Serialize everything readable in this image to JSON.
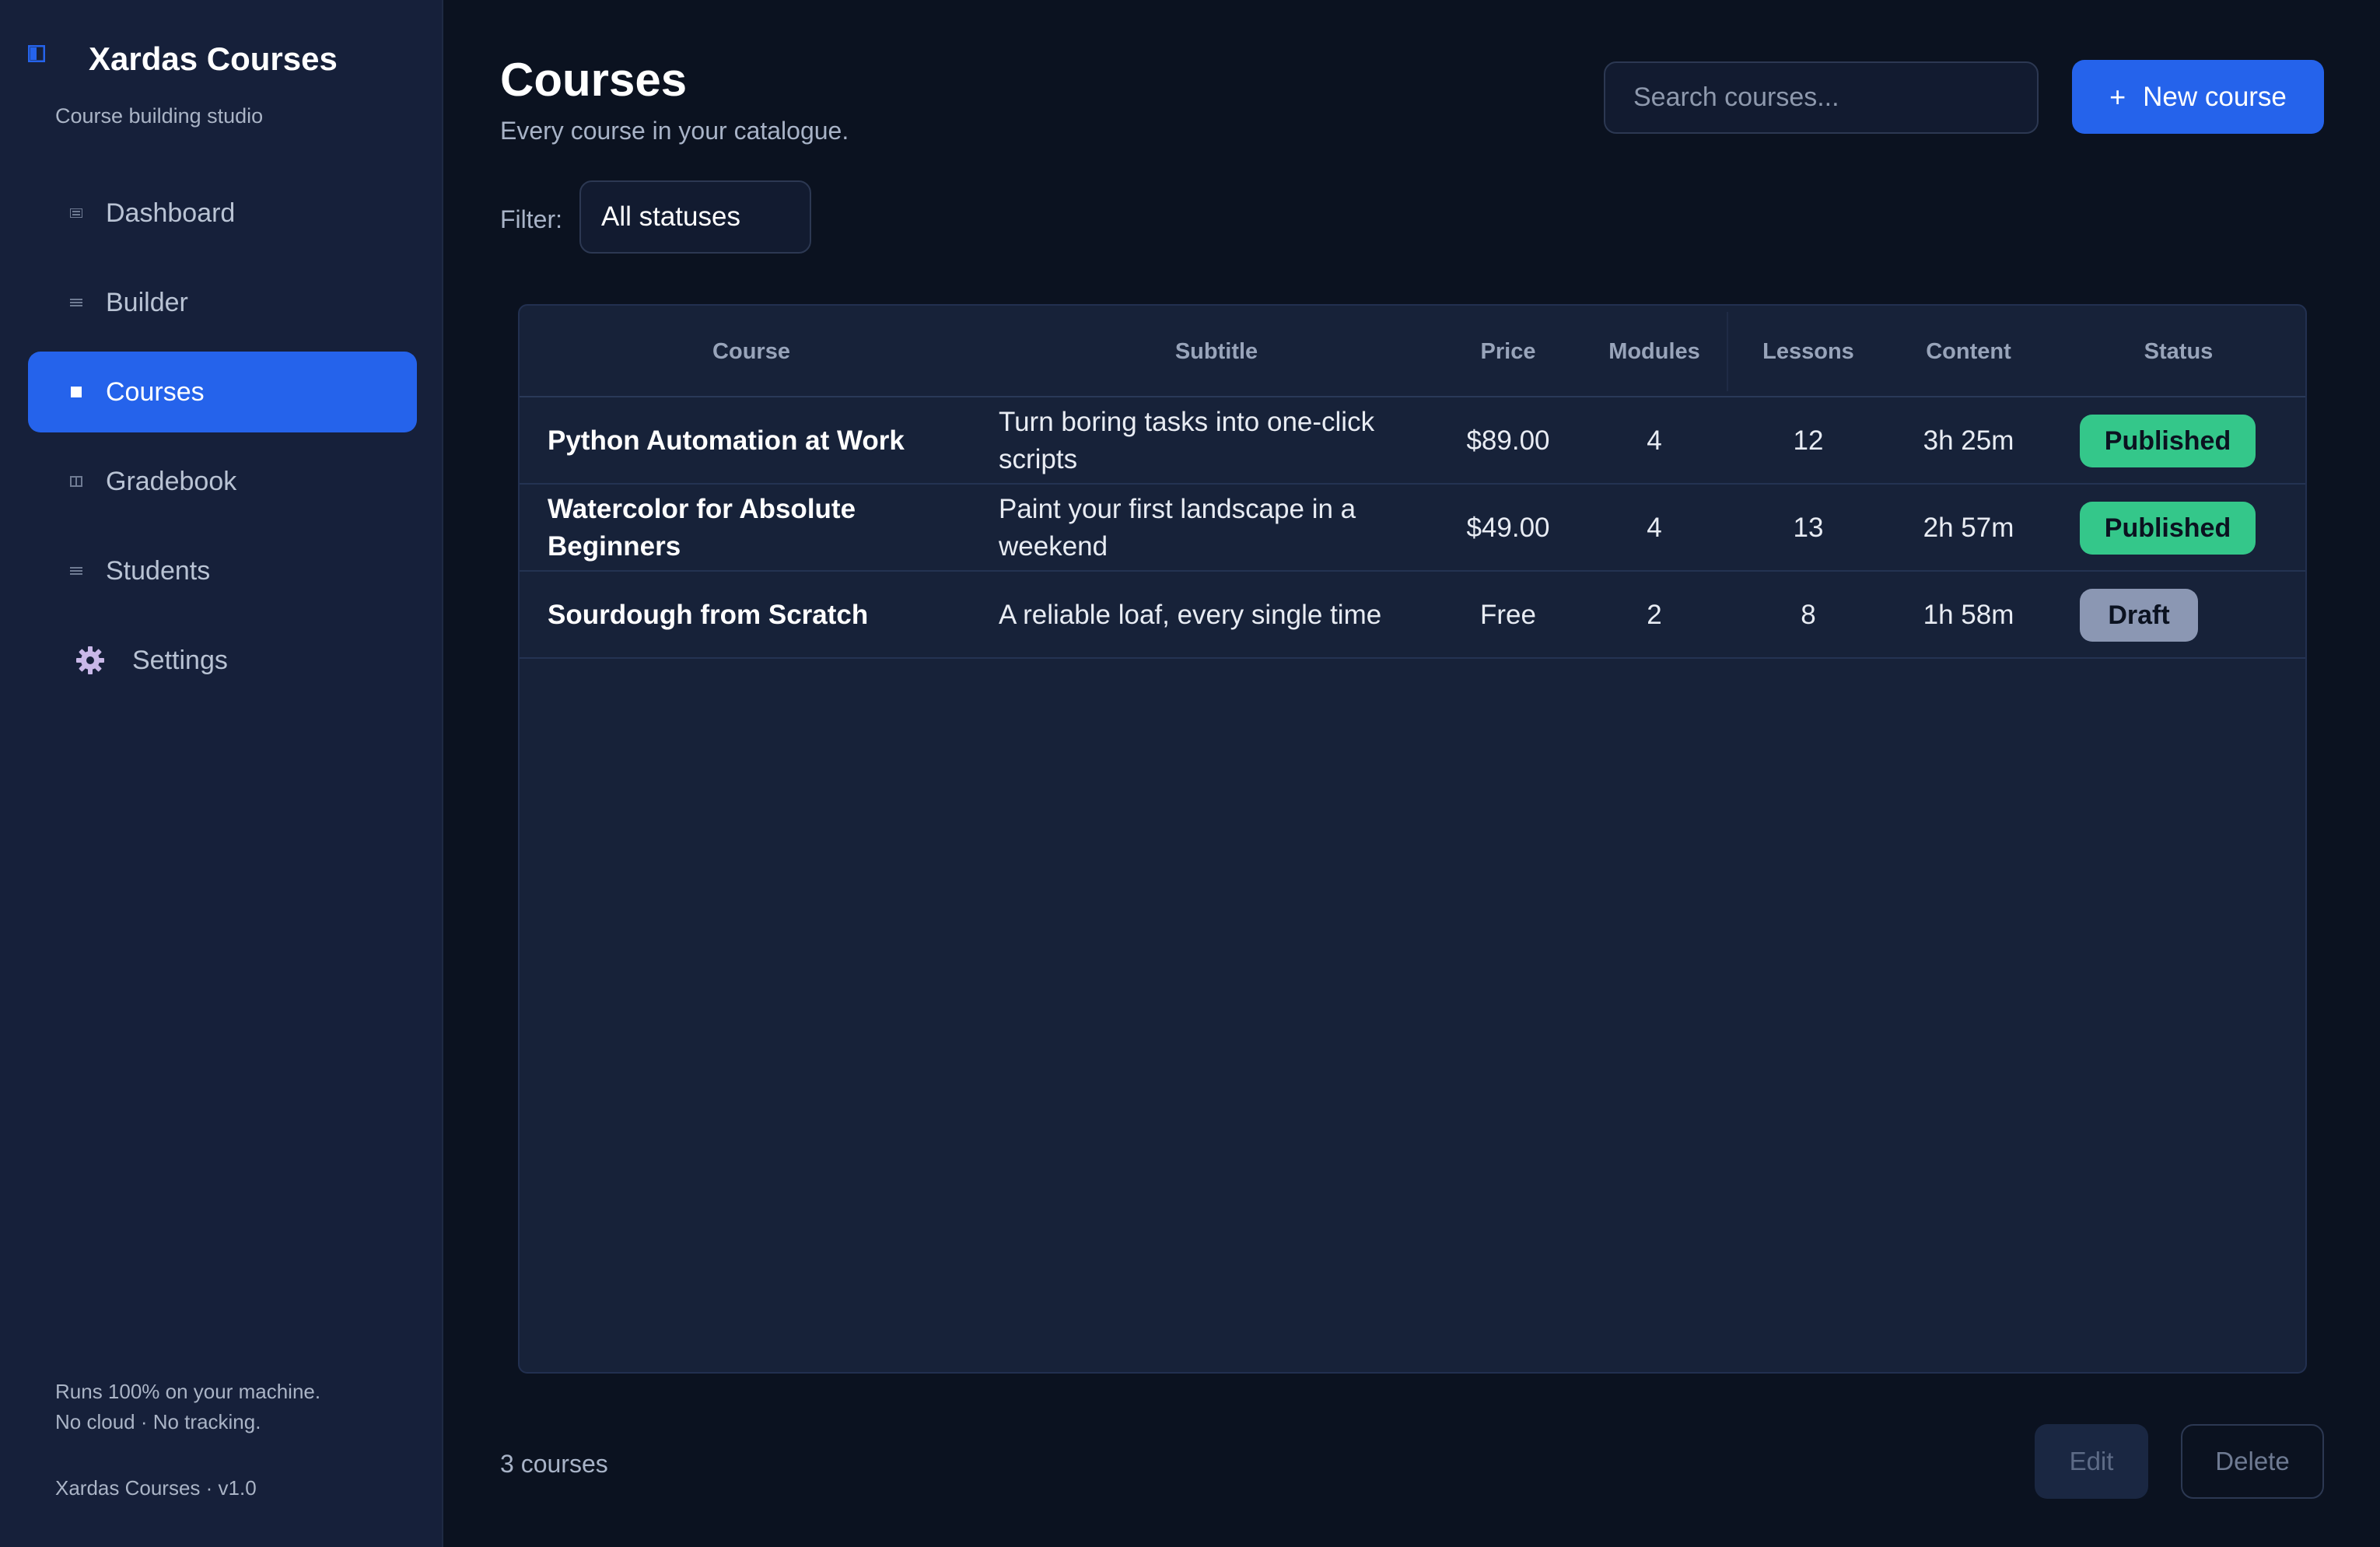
{
  "app": {
    "title": "Xardas Courses",
    "subtitle": "Course building studio",
    "footer_lines": [
      "Runs 100% on your machine.",
      "No cloud · No tracking."
    ],
    "version": "Xardas Courses · v1.0"
  },
  "sidebar": {
    "items": [
      {
        "label": "Dashboard",
        "icon": "dashboard-icon",
        "active": false
      },
      {
        "label": "Builder",
        "icon": "builder-icon",
        "active": false
      },
      {
        "label": "Courses",
        "icon": "courses-icon",
        "active": true
      },
      {
        "label": "Gradebook",
        "icon": "gradebook-icon",
        "active": false
      },
      {
        "label": "Students",
        "icon": "students-icon",
        "active": false
      },
      {
        "label": "Settings",
        "icon": "gear-icon",
        "active": false
      }
    ]
  },
  "header": {
    "title": "Courses",
    "subtitle": "Every course in your catalogue.",
    "search_placeholder": "Search courses...",
    "new_button_label": "New course",
    "new_button_icon": "+"
  },
  "filter": {
    "label": "Filter:",
    "selected": "All statuses"
  },
  "table": {
    "columns": [
      "Course",
      "Subtitle",
      "Price",
      "Modules",
      "Lessons",
      "Content",
      "Status"
    ],
    "rows": [
      {
        "course": "Python Automation at Work",
        "subtitle": "Turn boring tasks into one-click scripts",
        "price": "$89.00",
        "modules": "4",
        "lessons": "12",
        "content": "3h 25m",
        "status": "Published"
      },
      {
        "course": "Watercolor for Absolute Beginners",
        "subtitle": "Paint your first landscape in a weekend",
        "price": "$49.00",
        "modules": "4",
        "lessons": "13",
        "content": "2h 57m",
        "status": "Published"
      },
      {
        "course": "Sourdough from Scratch",
        "subtitle": "A reliable loaf, every single time",
        "price": "Free",
        "modules": "2",
        "lessons": "8",
        "content": "1h 58m",
        "status": "Draft"
      }
    ]
  },
  "footer": {
    "count": "3 courses",
    "edit_label": "Edit",
    "delete_label": "Delete"
  },
  "colors": {
    "accent": "#2563eb",
    "published": "#34c78a",
    "draft": "#8b97b3",
    "background": "#0b1220",
    "sidebar": "#16203a"
  }
}
